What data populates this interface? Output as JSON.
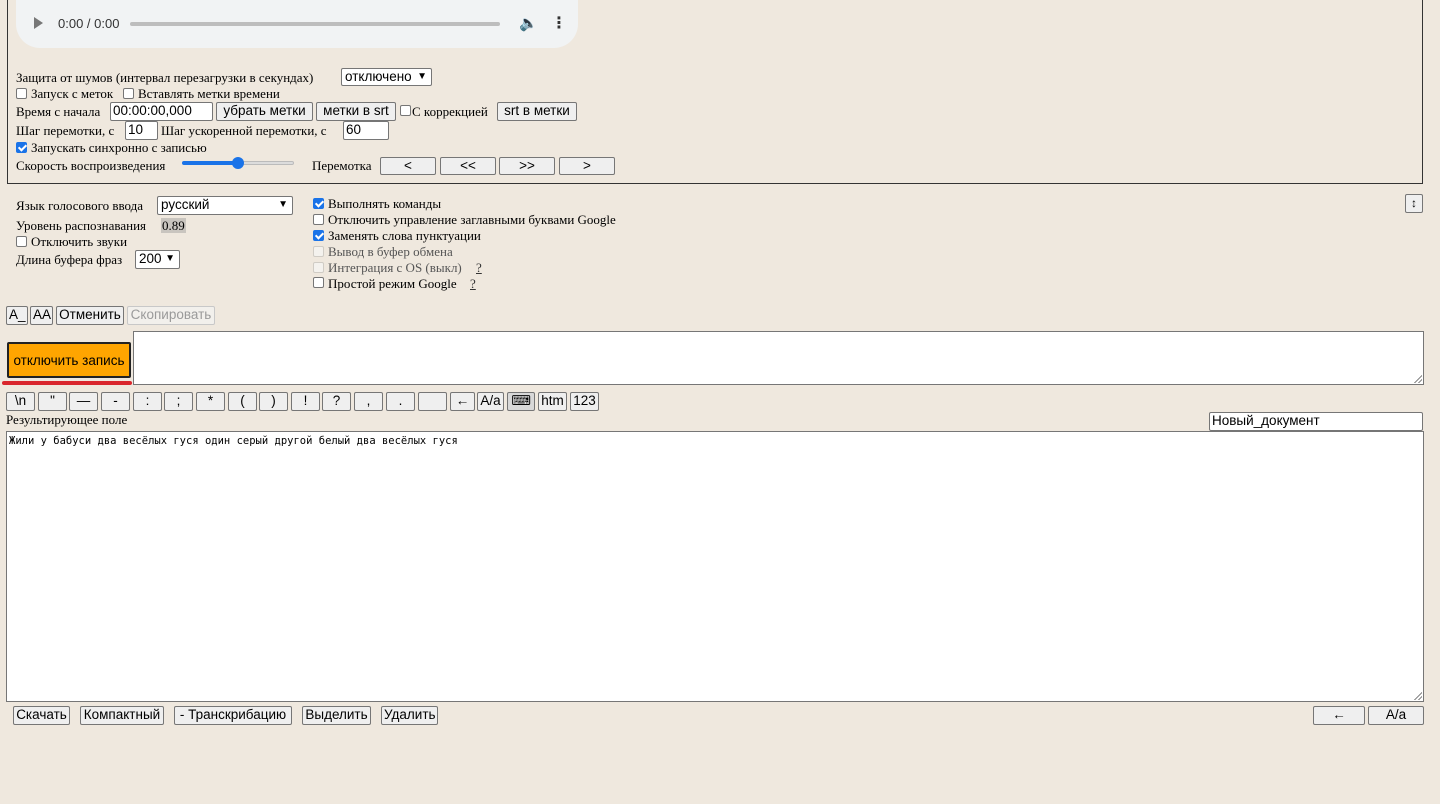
{
  "audio": {
    "time": "0:00 / 0:00",
    "play_icon": "play-icon",
    "volume_icon": "volume-icon",
    "menu_icon": "more-vert-icon"
  },
  "noise": {
    "label": "Защита от шумов (интервал перезагрузки в секундах)",
    "value": "отключено"
  },
  "opts": {
    "start_from_marks": "Запуск с меток",
    "insert_timestamps": "Вставлять метки времени"
  },
  "time": {
    "label": "Время с начала",
    "value": "00:00:00,000",
    "remove_marks": "убрать метки",
    "marks_to_srt": "метки в srt",
    "with_correction": "С коррекцией",
    "srt_to_marks": "srt в метки"
  },
  "step": {
    "label": "Шаг перемотки, с",
    "value": "10",
    "fast_label": "Шаг ускоренной перемотки, с",
    "fast_value": "60"
  },
  "sync": {
    "label": "Запускать синхронно с записью"
  },
  "speed": {
    "label": "Скорость воспроизведения",
    "level": 0.5
  },
  "rewind": {
    "label": "Перемотка",
    "b1": "<",
    "b2": "<<",
    "b3": ">>",
    "b4": ">"
  },
  "voice": {
    "lang_label": "Язык голосового ввода",
    "lang_value": "русский",
    "recog_label": "Уровень распознавания",
    "recog_value": "0.89",
    "mute_sounds": "Отключить звуки",
    "buffer_label": "Длина буфера фраз",
    "buffer_value": "200"
  },
  "flags": {
    "exec_commands": "Выполнять команды",
    "disable_caps": "Отключить управление заглавными буквами Google",
    "replace_punct": "Заменять слова пунктуации",
    "clipboard": "Вывод в буфер обмена",
    "os_integration": "Интеграция с OS (выкл)",
    "simple_google": "Простой режим Google",
    "help": "?",
    "expand_icon": "↕"
  },
  "edit": {
    "a_under": "A_",
    "aa": "AA",
    "undo": "Отменить",
    "copy": "Скопировать"
  },
  "record": {
    "label": "отключить запись"
  },
  "punct": [
    "\\n",
    "\"",
    "—",
    "-",
    ":",
    ";",
    "*",
    "(",
    ")",
    "!",
    "?",
    ",",
    ".",
    "",
    "←",
    "A/a",
    "",
    "htm",
    "123"
  ],
  "result": {
    "label": "Результирующее поле",
    "doc_name": "Новый_документ",
    "text": "Жили у бабуси два весёлых гуся один серый другой белый два весёлых гуся"
  },
  "bottom": {
    "download": "Скачать",
    "compact": "Компактный",
    "transcription": "- Транскрибацию",
    "select": "Выделить",
    "delete": "Удалить",
    "back": "←",
    "case": "A/a"
  },
  "colors": {
    "record_bg": "#ffa500",
    "accent": "#1a73e8",
    "underline": "#d9262c"
  }
}
